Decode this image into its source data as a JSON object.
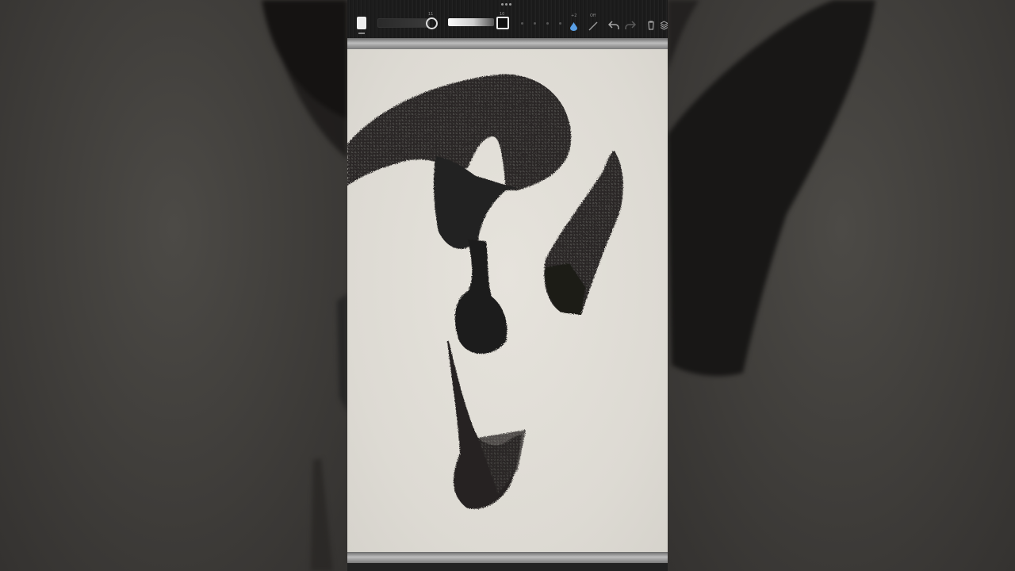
{
  "toolbar": {
    "brush_size_value": "11",
    "opacity_value": "10",
    "pressure_value": "+2",
    "stroke_mode_label": "Off"
  },
  "colors": {
    "ink": "#1e1c1b",
    "paper": "#e2dfd8",
    "water_accent": "#5aa0e6",
    "background": "#3b3936"
  }
}
